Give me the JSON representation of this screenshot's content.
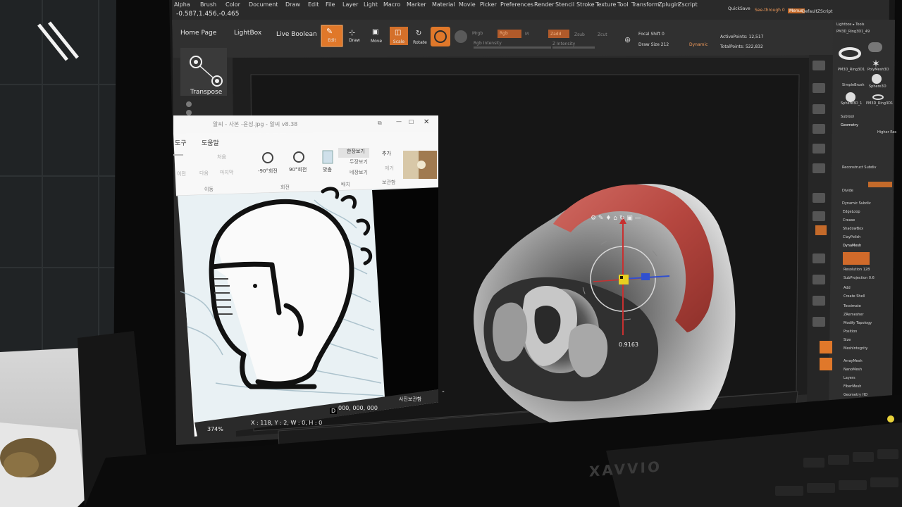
{
  "zbrush": {
    "menu": [
      "Alpha",
      "Brush",
      "Color",
      "Document",
      "Draw",
      "Edit",
      "File",
      "Layer",
      "Light",
      "Macro",
      "Marker",
      "Material",
      "Movie",
      "Picker",
      "Preferences",
      "Render",
      "Stencil",
      "Stroke",
      "Texture",
      "Tool",
      "Transform",
      "Zplugin",
      "Zscript"
    ],
    "menu_right": [
      "QuickSave",
      "See-through 0",
      "Menus",
      "DefaultZScript"
    ],
    "coords": "-0.587,1.456,-0.465",
    "top_buttons": {
      "home": "Home Page",
      "lightbox": "LightBox",
      "live_boolean": "Live Boolean"
    },
    "tools": [
      "Edit",
      "Draw",
      "Move",
      "Scale",
      "Rotate"
    ],
    "params": {
      "mrgb": "Mrgb",
      "rgb": "Rgb",
      "m": "M",
      "zadd": "Zadd",
      "zsub": "Zsub",
      "zcut": "Zcut",
      "rgb_intensity": "Rgb Intensity",
      "z_intensity": "Z Intensity",
      "focal_shift": "Focal Shift 0",
      "draw_size": "Draw Size 212",
      "dynamic": "Dynamic",
      "active_points": "ActivePoints: 12,517",
      "total_points": "TotalPoints: 522,832"
    },
    "transpose_label": "Transpose",
    "gizmo_value": "0.9163",
    "right_panel": {
      "header": "Lightbox ▸ Tools",
      "title": "PM3D_Ring3D1_49",
      "tools": [
        "PM3D_Ring3D1",
        "PolyMesh3D",
        "SimpleBrush",
        "Sphere3D",
        "Sphere3D_1",
        "PM3D_Ring3D1"
      ],
      "items": [
        "Subtool",
        "Geometry",
        "Higher Res",
        "Reconstruct Subdiv",
        "Divide",
        "Dynamic Subdiv",
        "EdgeLoop",
        "Crease",
        "ShadowBox",
        "ClayPolish",
        "DynaMesh",
        "Resolution 128",
        "SubProjection 0.6",
        "Add",
        "Create Shell",
        "Tessimate",
        "ZRemesher",
        "Modify Topology",
        "Position",
        "Size",
        "MeshIntegrity",
        "ArrayMesh",
        "NanoMesh",
        "Layers",
        "FiberMesh",
        "Geometry HD"
      ]
    }
  },
  "viewer": {
    "title": "알씨 - 사본 -윤성.jpg - 알씨 v8.38",
    "menus": [
      "도구",
      "도움말"
    ],
    "ribbon": {
      "prev": "이전",
      "next": "다음",
      "first": "처음",
      "last": "마지막",
      "rot_left": "-90°회전",
      "rot_right": "90°회전",
      "fit": "맞춤",
      "view1": "한장보기",
      "view2": "두장보기",
      "view4": "네장보기",
      "add": "추가",
      "remove": "제거",
      "group_move": "이동",
      "group_rotate": "회전",
      "group_layout": "배치",
      "group_storage": "보관함"
    },
    "status": {
      "zoom": "374%",
      "coords": "X : 118, Y : 2, W : 0, H : 0",
      "color": "000, 000, 000",
      "storage": "사진보관함"
    }
  },
  "monitor_brand": "XAVVIO",
  "colors": {
    "zbrush_orange": "#e0782a",
    "ring_red": "#c0504a",
    "viewport_bg": "#1c1c1c",
    "viewer_bg": "#f4f4f4"
  }
}
